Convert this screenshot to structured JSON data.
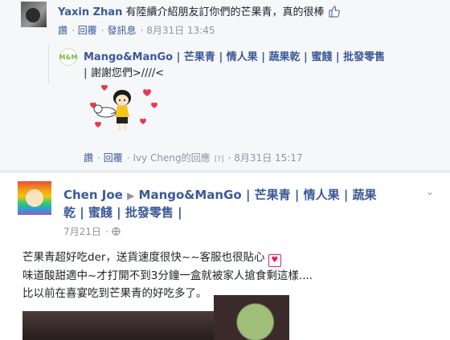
{
  "comment": {
    "author": "Yaxin Zhan",
    "text": "有陸續介紹朋友訂你們的芒果青，真的很棒",
    "actions": [
      "讚",
      "回覆",
      "發訊息"
    ],
    "time": "8月31日 13:45"
  },
  "reply": {
    "author": "Mango&ManGo",
    "avatar_text": "M&M",
    "tags_line1": "| 芒果青 | 情人果 | 蔬果乾 | 蜜餞 | 批發零售",
    "tags_line2": "|",
    "text": "謝謝您們>////<",
    "actions": [
      "讚",
      "回覆"
    ],
    "responder": "Ivy Cheng的回應",
    "question": "[?]",
    "time": "8月31日 15:17"
  },
  "post": {
    "author": "Chen Joe",
    "page": "Mango&ManGo",
    "tags_line1": "| 芒果青 | 情人果 | 蔬果",
    "tags_line2": "乾 | 蜜餞 | 批發零售 |",
    "time": "7月21日",
    "privacy_icon": "globe-icon",
    "lines": [
      "芒果青超好吃der，送貨速度很快~~客服也很貼心",
      "味道酸甜適中~才打開不到3分鐘一盒就被家人搶食剩這樣....",
      "比以前在喜宴吃到芒果青的好吃多了。"
    ]
  },
  "colors": {
    "link": "#3b5998",
    "meta": "#90949c",
    "heart": "#e0245e"
  }
}
